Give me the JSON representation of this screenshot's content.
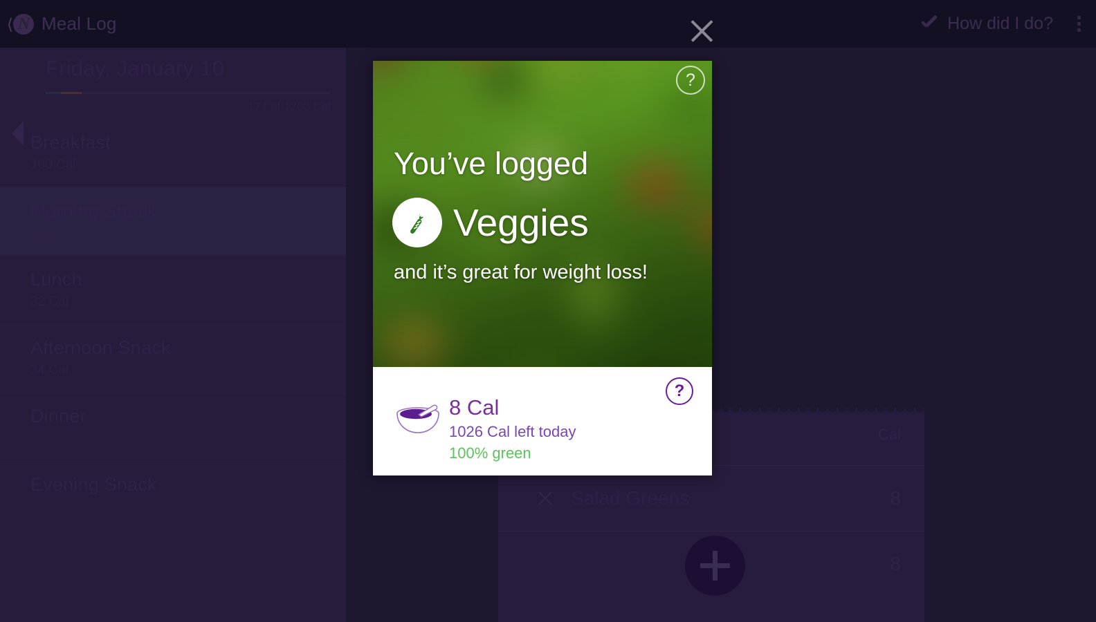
{
  "app": {
    "title": "Meal Log",
    "logo_icon": "nutrino-logo-icon",
    "how_did_i_do": "How did I do?",
    "check_icon": "check-icon",
    "overflow_icon": "overflow-menu-icon",
    "close_icon": "close-icon"
  },
  "colors": {
    "accent_purple": "#6a1b9a",
    "green": "#5ec15e",
    "panel_bg": "#271c3c",
    "right_bg": "#1e1730",
    "actionbar_bg": "#141024"
  },
  "left_pane": {
    "prev_day_icon": "previous-day-arrow-icon",
    "date": "Friday, January 10",
    "calorie_summary": "174 of 1200 Cal",
    "progress": {
      "consumed": 174,
      "goal": 1200
    },
    "meals": [
      {
        "name": "Breakfast",
        "calories": "100 Cal",
        "selected": false
      },
      {
        "name": "Morning Snack",
        "calories": "8 Cal",
        "selected": true
      },
      {
        "name": "Lunch",
        "calories": "32 Cal",
        "selected": false
      },
      {
        "name": "Afternoon Snack",
        "calories": "34 Cal",
        "selected": false
      },
      {
        "name": "Dinner",
        "calories": "",
        "selected": false
      },
      {
        "name": "Evening Snack",
        "calories": "",
        "selected": false
      }
    ]
  },
  "right_pane": {
    "food_card": {
      "column_header": "Cal",
      "rows": [
        {
          "remove_icon": "remove-item-icon",
          "name": "Salad Greens",
          "calories": "8"
        },
        {
          "remove_icon": "remove-item-icon",
          "name": "",
          "calories": "8"
        }
      ]
    },
    "add_button": {
      "icon": "plus-icon",
      "label": ""
    }
  },
  "modal": {
    "help_top_icon": "help-circle-icon",
    "help_bottom_icon": "help-circle-icon",
    "headline": "You’ve logged",
    "category": "Veggies",
    "category_icon": "carrot-icon",
    "tagline": "and it’s great for weight loss!",
    "bowl_icon": "bowl-with-spoon-icon",
    "stat_calories": "8 Cal",
    "stat_remaining": "1026 Cal left today",
    "stat_green": "100% green"
  }
}
